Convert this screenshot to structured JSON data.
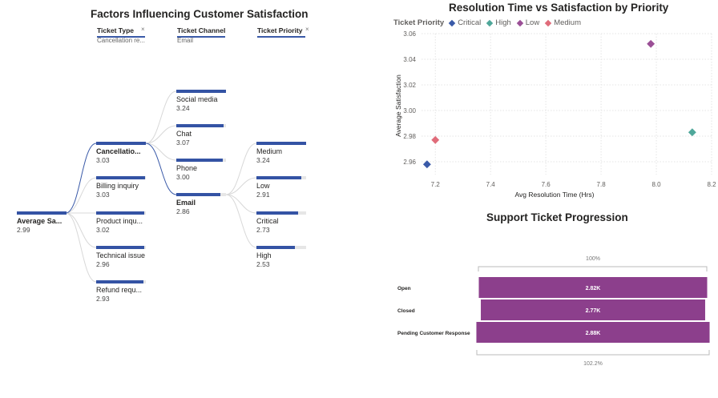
{
  "colors": {
    "tree_bar": "#3453a4",
    "tree_bar_bg": "#e6e6e6",
    "funnel": "#8c3f8c",
    "critical": "#3a5aa8",
    "high": "#4fa79a",
    "low": "#9b4f96",
    "medium": "#e06c7a"
  },
  "decomp_tree": {
    "title": "Factors Influencing Customer Satisfaction",
    "levels": [
      {
        "header": "Ticket Type",
        "selected": "Cancellation re..."
      },
      {
        "header": "Ticket Channel",
        "selected": "Email"
      },
      {
        "header": "Ticket Priority",
        "selected": ""
      }
    ],
    "root": {
      "label": "Average Sa...",
      "value": "2.99"
    },
    "ticket_type": [
      {
        "label": "Cancellatio...",
        "value": "3.03"
      },
      {
        "label": "Billing inquiry",
        "value": "3.03"
      },
      {
        "label": "Product inqu...",
        "value": "3.02"
      },
      {
        "label": "Technical issue",
        "value": "2.96"
      },
      {
        "label": "Refund requ...",
        "value": "2.93"
      }
    ],
    "ticket_channel": [
      {
        "label": "Social media",
        "value": "3.24"
      },
      {
        "label": "Chat",
        "value": "3.07"
      },
      {
        "label": "Phone",
        "value": "3.00"
      },
      {
        "label": "Email",
        "value": "2.86"
      }
    ],
    "ticket_priority": [
      {
        "label": "Medium",
        "value": "3.24"
      },
      {
        "label": "Low",
        "value": "2.91"
      },
      {
        "label": "Critical",
        "value": "2.73"
      },
      {
        "label": "High",
        "value": "2.53"
      }
    ]
  },
  "chart_data": [
    {
      "type": "scatter",
      "title": "Resolution Time vs Satisfaction by Priority",
      "xlabel": "Avg Resolution Time (Hrs)",
      "ylabel": "Average Satisfaction",
      "xlim": [
        7.15,
        8.2
      ],
      "ylim": [
        2.95,
        3.06
      ],
      "xticks": [
        7.2,
        7.4,
        7.6,
        7.8,
        8.0,
        8.2
      ],
      "xtick_labels": [
        "7.2",
        "7.4",
        "7.6",
        "7.8",
        "8.0",
        "8.2"
      ],
      "yticks": [
        2.96,
        2.98,
        3.0,
        3.02,
        3.04,
        3.06
      ],
      "ytick_labels": [
        "2.96",
        "2.98",
        "3.00",
        "3.02",
        "3.04",
        "3.06"
      ],
      "grid": true,
      "legend_title": "Ticket Priority",
      "legend_position": "top-left",
      "series": [
        {
          "name": "Critical",
          "color": "#3a5aa8",
          "x": [
            7.17
          ],
          "y": [
            2.958
          ]
        },
        {
          "name": "High",
          "color": "#4fa79a",
          "x": [
            8.13
          ],
          "y": [
            2.983
          ]
        },
        {
          "name": "Low",
          "color": "#9b4f96",
          "x": [
            7.98
          ],
          "y": [
            3.052
          ]
        },
        {
          "name": "Medium",
          "color": "#e06c7a",
          "x": [
            7.2
          ],
          "y": [
            2.977
          ]
        }
      ]
    },
    {
      "type": "bar",
      "orientation": "funnel",
      "title": "Support Ticket Progression",
      "categories": [
        "Open",
        "Closed",
        "Pending Customer Response"
      ],
      "values": [
        2820,
        2770,
        2880
      ],
      "data_labels": [
        "2.82K",
        "2.77K",
        "2.88K"
      ],
      "top_label": "100%",
      "bottom_label": "102.2%",
      "color": "#8c3f8c"
    }
  ]
}
